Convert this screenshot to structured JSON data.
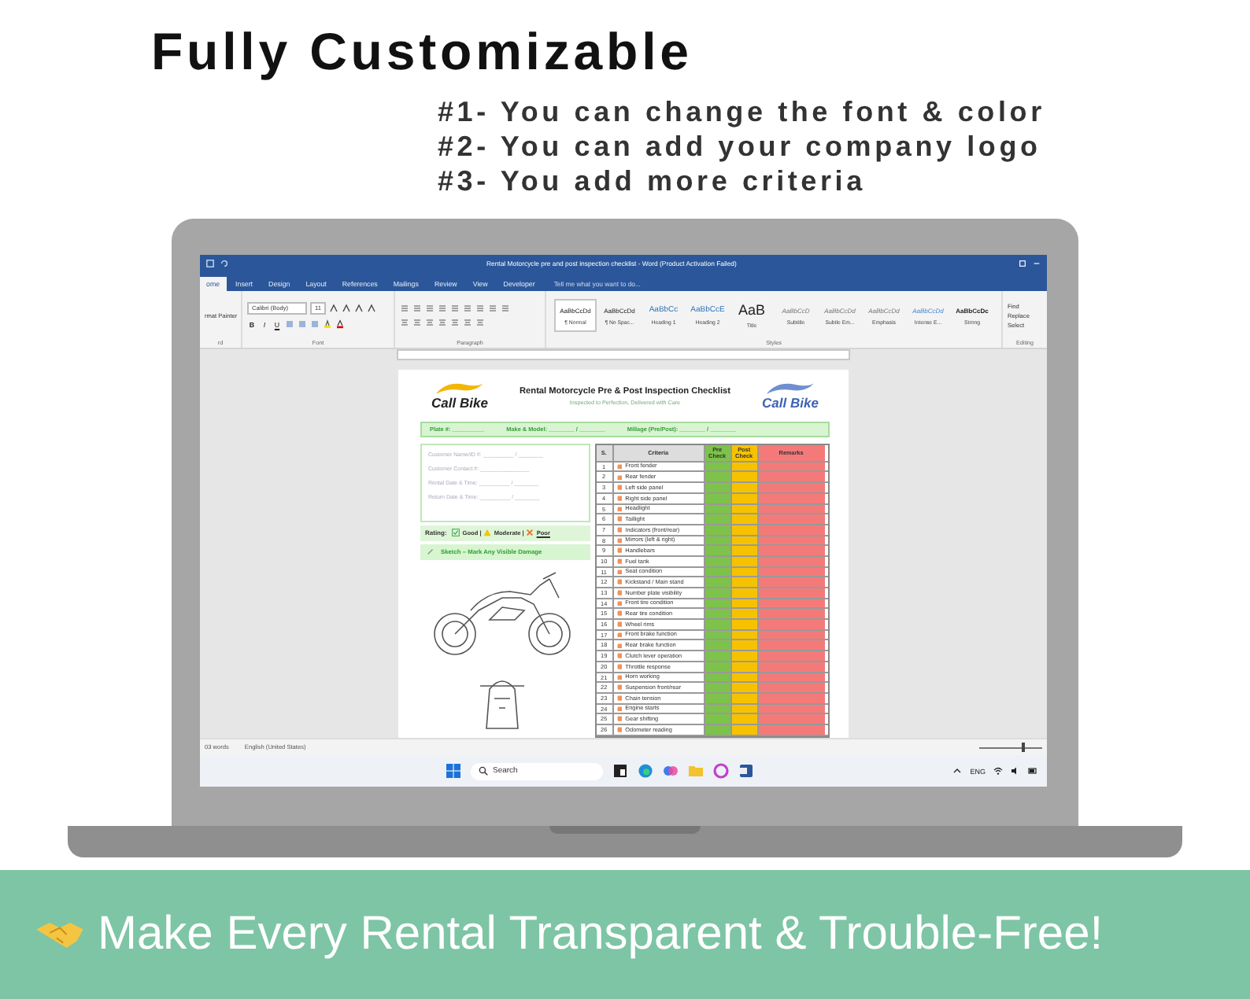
{
  "headline": "Fully Customizable",
  "features": [
    "#1- You can change the font & color",
    "#2- You can add your company logo",
    "#3- You add more criteria"
  ],
  "word": {
    "title": "Rental Motorcycle pre and post inspection checklist - Word (Product Activation Failed)",
    "tabs": [
      {
        "label": "ome",
        "selected": true
      },
      {
        "label": "Insert",
        "selected": false
      },
      {
        "label": "Design",
        "selected": false
      },
      {
        "label": "Layout",
        "selected": false
      },
      {
        "label": "References",
        "selected": false
      },
      {
        "label": "Mailings",
        "selected": false
      },
      {
        "label": "Review",
        "selected": false
      },
      {
        "label": "View",
        "selected": false
      },
      {
        "label": "Developer",
        "selected": false
      }
    ],
    "tell_me": "Tell me what you want to do...",
    "clipboard": {
      "item": "rmat Painter",
      "label": "rd"
    },
    "font": {
      "name": "Calibri (Body)",
      "size": "11",
      "format_buttons": [
        "B",
        "I",
        "U"
      ],
      "label": "Font"
    },
    "paragraph": {
      "label": "Paragraph"
    },
    "styles": {
      "label": "Styles",
      "items": [
        {
          "sample": "AaBbCcDd",
          "name": "¶ Normal",
          "kind": "body",
          "selected": true
        },
        {
          "sample": "AaBbCcDd",
          "name": "¶ No Spac...",
          "kind": "body",
          "selected": false
        },
        {
          "sample": "AaBbCc",
          "name": "Heading 1",
          "kind": "heading",
          "selected": false
        },
        {
          "sample": "AaBbCcE",
          "name": "Heading 2",
          "kind": "heading",
          "selected": false
        },
        {
          "sample": "AaB",
          "name": "Title",
          "kind": "title",
          "selected": false
        },
        {
          "sample": "AaBbCcD",
          "name": "Subtitle",
          "kind": "subtle",
          "selected": false
        },
        {
          "sample": "AaBbCcDd",
          "name": "Subtle Em...",
          "kind": "subtle",
          "selected": false
        },
        {
          "sample": "AaBbCcDd",
          "name": "Emphasis",
          "kind": "subtle",
          "selected": false
        },
        {
          "sample": "AaBbCcDd",
          "name": "Intense E...",
          "kind": "intense",
          "selected": false
        },
        {
          "sample": "AaBbCcDc",
          "name": "Strong",
          "kind": "strong",
          "selected": false
        }
      ]
    },
    "editing": {
      "label": "Editing",
      "items": [
        "Find",
        "Replace",
        "Select"
      ]
    },
    "document": {
      "logo_texts": [
        "Call Bike",
        "Call Bike"
      ],
      "title": "Rental Motorcycle Pre & Post Inspection Checklist",
      "tagline": "Inspected to Perfection, Delivered with Care",
      "vehicle_fields": [
        "Plate #: __________",
        "Make & Model: ________ / ________",
        "Millage (Pre/Post): ________ / ________"
      ],
      "customer_fields": [
        "Customer Name/ID #: __________ / ________",
        "Customer Contact #: ________________",
        "Rental Date & Time: __________ / ________",
        "Return Date & Time: __________ / ________"
      ],
      "rating": {
        "label": "Rating:",
        "options": [
          {
            "kind": "good",
            "text": "Good |"
          },
          {
            "kind": "moderate",
            "text": "Moderate |"
          },
          {
            "kind": "poor",
            "text": "Poor"
          }
        ]
      },
      "sketch": "Sketch – Mark Any Visible Damage",
      "table": {
        "columns": [
          "S.",
          "Criteria",
          "Pre Check",
          "Post Check",
          "Remarks"
        ],
        "rows": [
          {
            "n": "1",
            "criteria": "Front fender"
          },
          {
            "n": "2",
            "criteria": "Rear fender"
          },
          {
            "n": "3",
            "criteria": "Left side panel"
          },
          {
            "n": "4",
            "criteria": "Right side panel"
          },
          {
            "n": "5",
            "criteria": "Headlight"
          },
          {
            "n": "6",
            "criteria": "Taillight"
          },
          {
            "n": "7",
            "criteria": "Indicators (front/rear)"
          },
          {
            "n": "8",
            "criteria": "Mirrors (left & right)"
          },
          {
            "n": "9",
            "criteria": "Handlebars"
          },
          {
            "n": "10",
            "criteria": "Fuel tank"
          },
          {
            "n": "11",
            "criteria": "Seat condition"
          },
          {
            "n": "12",
            "criteria": "Kickstand / Main stand"
          },
          {
            "n": "13",
            "criteria": "Number plate visibility"
          },
          {
            "n": "14",
            "criteria": "Front tire condition"
          },
          {
            "n": "15",
            "criteria": "Rear tire condition"
          },
          {
            "n": "16",
            "criteria": "Wheel rims"
          },
          {
            "n": "17",
            "criteria": "Front brake function"
          },
          {
            "n": "18",
            "criteria": "Rear brake function"
          },
          {
            "n": "19",
            "criteria": "Clutch lever operation"
          },
          {
            "n": "20",
            "criteria": "Throttle response"
          },
          {
            "n": "21",
            "criteria": "Horn working"
          },
          {
            "n": "22",
            "criteria": "Suspension front/rear"
          },
          {
            "n": "23",
            "criteria": "Chain tension"
          },
          {
            "n": "24",
            "criteria": "Engine starts"
          },
          {
            "n": "25",
            "criteria": "Gear shifting"
          },
          {
            "n": "26",
            "criteria": "Odometer reading"
          }
        ]
      }
    },
    "status_bar": {
      "words": "03 words",
      "language": "English (United States)",
      "zoom": {
        "level": 0.68
      }
    }
  },
  "taskbar": {
    "search": "Search",
    "language": "ENG"
  },
  "banner": "Make Every Rental Transparent & Trouble-Free!"
}
